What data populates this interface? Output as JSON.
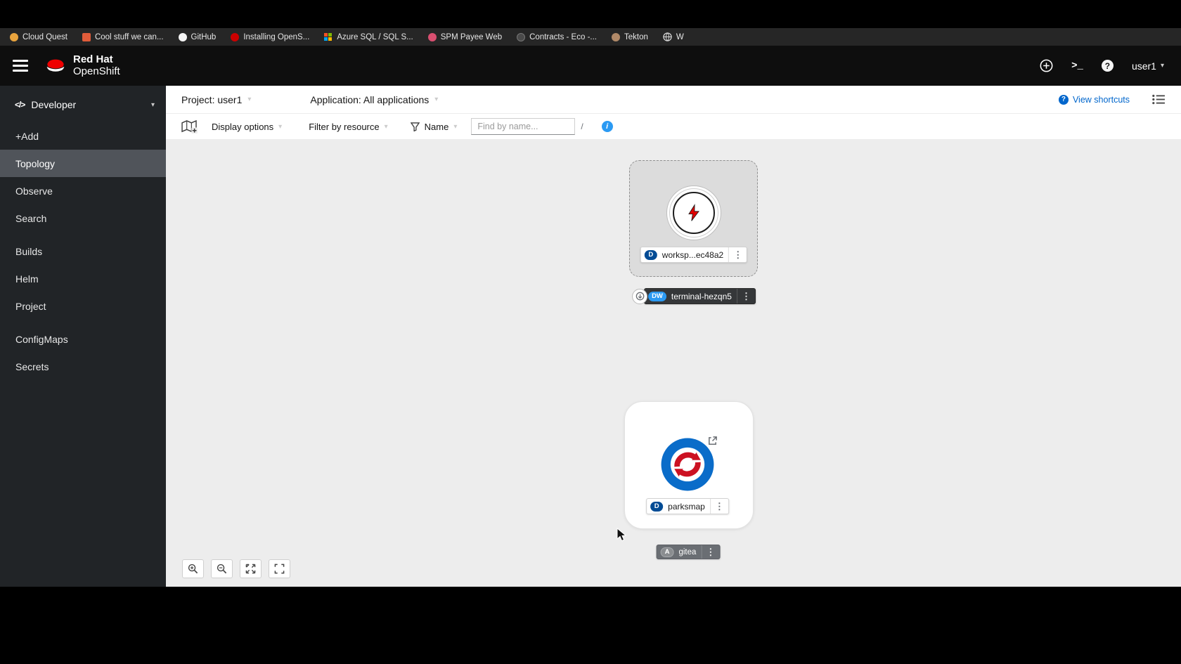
{
  "browser_bookmarks": {
    "items": [
      {
        "label": "Cloud Quest"
      },
      {
        "label": "Cool stuff we can..."
      },
      {
        "label": "GitHub"
      },
      {
        "label": "Installing OpenS..."
      },
      {
        "label": "Azure SQL / SQL S..."
      },
      {
        "label": "SPM Payee Web"
      },
      {
        "label": "Contracts - Eco -..."
      },
      {
        "label": "Tekton"
      },
      {
        "label": "W"
      }
    ]
  },
  "masthead": {
    "brand_line1": "Red Hat",
    "brand_line2": "OpenShift",
    "username": "user1"
  },
  "sidebar": {
    "perspective": "Developer",
    "items": [
      {
        "label": "+Add"
      },
      {
        "label": "Topology"
      },
      {
        "label": "Observe"
      },
      {
        "label": "Search"
      },
      {
        "label": "Builds"
      },
      {
        "label": "Helm"
      },
      {
        "label": "Project"
      },
      {
        "label": "ConfigMaps"
      },
      {
        "label": "Secrets"
      }
    ],
    "selected": "Topology"
  },
  "context_bar": {
    "project": "Project: user1",
    "application": "Application: All applications",
    "view_shortcuts": "View shortcuts"
  },
  "toolbar": {
    "display_options": "Display options",
    "filter_by_resource": "Filter by resource",
    "filter_type": "Name",
    "search_placeholder": "Find by name...",
    "shortcut_key": "/"
  },
  "topology": {
    "workspace": {
      "badge": "D",
      "label": "worksp...ec48a2"
    },
    "terminal": {
      "badge": "DW",
      "label": "terminal-hezqn5"
    },
    "parksmap": {
      "badge": "D",
      "label": "parksmap"
    },
    "gitea": {
      "badge": "A",
      "label": "gitea"
    }
  },
  "colors": {
    "accent_blue": "#0066cc",
    "badge_deployment": "#004b95",
    "badge_devworkspace": "#2b9af3",
    "badge_application": "#8a8d90",
    "brand_red": "#ee0000"
  }
}
